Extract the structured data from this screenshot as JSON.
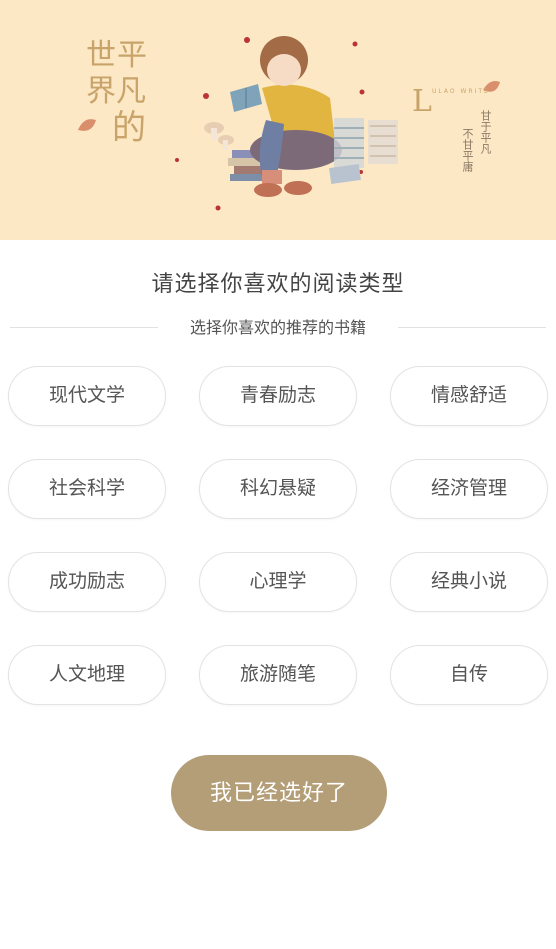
{
  "banner": {
    "title_line1": "世平",
    "title_line2": "界凡",
    "title_line3": "的",
    "logo_letter": "L",
    "logo_small": "ULAO WRITE",
    "side_text_1": "甘于平凡",
    "side_text_2": "不甘平庸"
  },
  "heading": "请选择你喜欢的阅读类型",
  "subtitle": "选择你喜欢的推荐的书籍",
  "categories": [
    "现代文学",
    "青春励志",
    "情感舒适",
    "社会科学",
    "科幻悬疑",
    "经济管理",
    "成功励志",
    "心理学",
    "经典小说",
    "人文地理",
    "旅游随笔",
    "自传"
  ],
  "confirm_label": "我已经选好了",
  "colors": {
    "banner_bg": "#fde8c6",
    "accent": "#b49e77",
    "chip_border": "#e3e3e3"
  }
}
